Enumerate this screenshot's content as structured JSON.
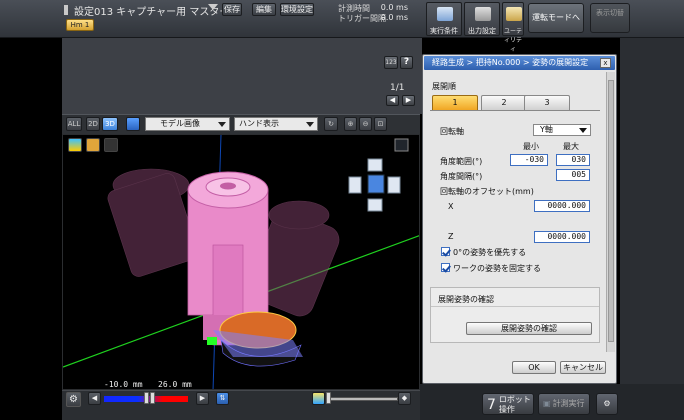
{
  "topbar": {
    "title": "設定013 キャプチャー用 マスター",
    "save": "保存",
    "edit": "編集",
    "env": "環境設定",
    "measure_time_label": "計測時間",
    "trigger_interval_label": "トリガー間隔",
    "measure_time_value": "0.0 ms",
    "trigger_interval_value": "0.0 ms",
    "tab_label": "Hm 1",
    "tools": [
      {
        "label": "実行条件"
      },
      {
        "label": "出力設定"
      },
      {
        "label": "ユーティリティ"
      }
    ],
    "mode_button": "運転モードへ",
    "mode_button2": "表示切替"
  },
  "upper": {
    "page_indicator": "1/1",
    "prev": "◀",
    "next": "▶",
    "help": "?",
    "small_icon": "123"
  },
  "view_toolbar": {
    "buttons": [
      "ALL",
      "2D",
      "3D"
    ],
    "model_select": "モデル画像",
    "hand_select": "ハンド表示"
  },
  "range": {
    "min": "-10.0 mm",
    "max": "26.0 mm"
  },
  "dialog": {
    "title": "経路生成 > 把持No.000 > 姿勢の展開設定",
    "close": "x",
    "order_label": "展開順",
    "tabs": [
      "1",
      "2",
      "3"
    ],
    "rotation_axis_label": "回転軸",
    "rotation_axis_value": "Y軸",
    "min_label": "最小",
    "max_label": "最大",
    "angle_range_label": "角度範囲(°)",
    "angle_range_min": "-030",
    "angle_range_max": "030",
    "angle_interval_label": "角度間隔(°)",
    "angle_interval_value": "005",
    "offset_label": "回転軸のオフセット(mm)",
    "x_label": "X",
    "x_value": "0000.000",
    "z_label": "Z",
    "z_value": "0000.000",
    "check1": "0°の姿勢を優先する",
    "check2": "ワークの姿勢を固定する",
    "confirm_section": "展開姿勢の確認",
    "confirm_button": "展開姿勢の確認",
    "ok": "OK",
    "cancel": "キャンセル"
  },
  "bottom_right": {
    "robot_btn": "ロボット操作",
    "measure_btn": "計測実行"
  }
}
